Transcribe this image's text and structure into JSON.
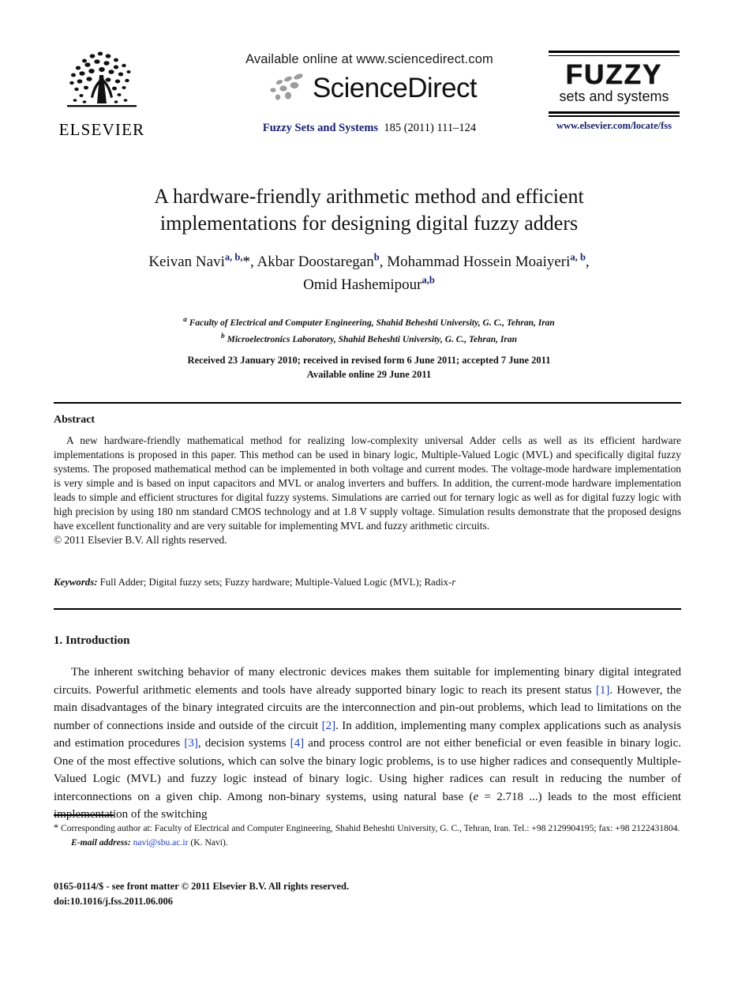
{
  "masthead": {
    "publisher_logo_word": "ELSEVIER",
    "publisher_logo_icon": "elsevier-tree-icon",
    "available_online": "Available online at www.sciencedirect.com",
    "sciencedirect_word": "ScienceDirect",
    "sciencedirect_icon": "sciencedirect-swoosh-icon",
    "journal_name": "Fuzzy Sets and Systems",
    "journal_volume_pages": "185 (2011) 111–124",
    "fuzzy_logo_title": "FUZZY",
    "fuzzy_logo_subtitle": "sets and systems",
    "journal_url": "www.elsevier.com/locate/fss"
  },
  "article": {
    "title_line1": "A hardware-friendly arithmetic method and efficient",
    "title_line2": "implementations for designing digital fuzzy adders",
    "authors": [
      {
        "name": "Keivan Navi",
        "sup": "a, b,",
        "star": "*",
        "sep": ", "
      },
      {
        "name": "Akbar Doostaregan",
        "sup": "b",
        "star": "",
        "sep": ", "
      },
      {
        "name": "Mohammad Hossein Moaiyeri",
        "sup": "a, b",
        "star": "",
        "sep": ", "
      },
      {
        "name": "Omid Hashemipour",
        "sup": "a,b",
        "star": "",
        "sep": ""
      }
    ],
    "affiliations": [
      {
        "marker": "a",
        "text": "Faculty of Electrical and Computer Engineering, Shahid Beheshti University, G. C., Tehran, Iran"
      },
      {
        "marker": "b",
        "text": "Microelectronics Laboratory, Shahid Beheshti University, G. C., Tehran, Iran"
      }
    ],
    "dates_line1": "Received 23 January 2010; received in revised form 6 June 2011; accepted 7 June 2011",
    "dates_line2": "Available online 29 June 2011"
  },
  "abstract": {
    "heading": "Abstract",
    "text": "A new hardware-friendly mathematical method for realizing low-complexity universal Adder cells as well as its efficient hardware implementations is proposed in this paper. This method can be used in binary logic, Multiple-Valued Logic (MVL) and specifically digital fuzzy systems. The proposed mathematical method can be implemented in both voltage and current modes. The voltage-mode hardware implementation is very simple and is based on input capacitors and MVL or analog inverters and buffers. In addition, the current-mode hardware implementation leads to simple and efficient structures for digital fuzzy systems. Simulations are carried out for ternary logic as well as for digital fuzzy logic with high precision by using 180 nm standard CMOS technology and at 1.8 V supply voltage. Simulation results demonstrate that the proposed designs have excellent functionality and are very suitable for implementing MVL and fuzzy arithmetic circuits.",
    "copyright": "© 2011 Elsevier B.V. All rights reserved."
  },
  "keywords": {
    "label": "Keywords:",
    "text": " Full Adder; Digital fuzzy sets; Fuzzy hardware; Multiple-Valued Logic (MVL); Radix-",
    "last_italic": "r"
  },
  "section": {
    "heading": "1. Introduction",
    "paragraph_part1": "The inherent switching behavior of many electronic devices makes them suitable for implementing binary digital integrated circuits. Powerful arithmetic elements and tools have already supported binary logic to reach its present status ",
    "cite1": "[1]",
    "paragraph_part2": ". However, the main disadvantages of the binary integrated circuits are the interconnection and pin-out problems, which lead to limitations on the number of connections inside and outside of the circuit ",
    "cite2": "[2]",
    "paragraph_part3": ". In addition, implementing many complex applications such as analysis and estimation procedures ",
    "cite3": "[3]",
    "paragraph_part4": ", decision systems ",
    "cite4": "[4]",
    "paragraph_part5": " and process control are not either beneficial or even feasible in binary logic. One of the most effective solutions, which can solve the binary logic problems, is to use higher radices and consequently Multiple-Valued Logic (MVL) and fuzzy logic instead of binary logic. Using higher radices can result in reducing the number of interconnections on a given chip. Among non-binary systems, using natural base (",
    "math_e": "e",
    "paragraph_part6": " = 2.718 ...) leads to the most efficient implementation of the switching"
  },
  "footnote": {
    "star": "*",
    "corresponding": " Corresponding author at: Faculty of Electrical and Computer Engineering, Shahid Beheshti University, G. C., Tehran, Iran. Tel.: +98 2129904195; fax: +98 2122431804.",
    "email_label": "E-mail address:",
    "email": "navi@sbu.ac.ir",
    "email_owner": " (K. Navi)."
  },
  "imprint": {
    "issn_line": "0165-0114/$ - see front matter © 2011 Elsevier B.V. All rights reserved.",
    "doi_line": "doi:10.1016/j.fss.2011.06.006"
  }
}
